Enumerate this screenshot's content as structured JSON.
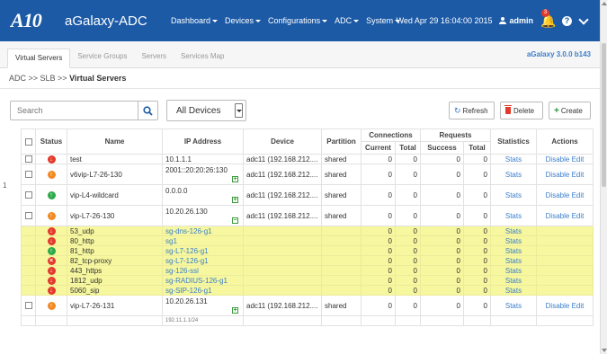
{
  "app": {
    "logo_text": "A10",
    "title": "aGalaxy-ADC",
    "nav": [
      "Dashboard",
      "Devices",
      "Configurations",
      "ADC",
      "System"
    ],
    "datetime": "Wed Apr 29 16:04:00 2015",
    "user": "admin",
    "notifications": "3",
    "help": "?"
  },
  "tabs": [
    "Virtual Servers",
    "Service Groups",
    "Servers",
    "Services Map"
  ],
  "version": "aGalaxy 3.0.0 b143",
  "breadcrumb": {
    "prefix": "ADC  >>  SLB  >>",
    "current": "Virtual Servers"
  },
  "toolbar": {
    "search_placeholder": "Search",
    "device_select": "All Devices",
    "refresh": "Refresh",
    "delete": "Delete",
    "create": "Create"
  },
  "table": {
    "group_headers": {
      "connections": "Connections",
      "requests": "Requests"
    },
    "headers": {
      "status": "Status",
      "name": "Name",
      "ip": "IP Address",
      "device": "Device",
      "partition": "Partition",
      "current": "Current",
      "total": "Total",
      "success": "Success",
      "req_total": "Total",
      "statistics": "Statistics",
      "actions": "Actions"
    },
    "rows": [
      {
        "name": "test",
        "ip": "10.1.1.1",
        "device": "adc11 (192.168.212....",
        "partition": "shared",
        "current": "0",
        "total": "0",
        "success": "0",
        "req_total": "0",
        "stats": "Stats",
        "disable": "Disable",
        "edit": "Edit"
      },
      {
        "name": "v6vip-L7-26-130",
        "ip": "2001::20:20:26:130",
        "device": "adc11 (192.168.212....",
        "partition": "shared",
        "current": "0",
        "total": "0",
        "success": "0",
        "req_total": "0",
        "stats": "Stats",
        "disable": "Disable",
        "edit": "Edit"
      },
      {
        "name": "vip-L4-wildcard",
        "ip": "0.0.0.0",
        "device": "adc11 (192.168.212....",
        "partition": "shared",
        "current": "0",
        "total": "0",
        "success": "0",
        "req_total": "0",
        "stats": "Stats",
        "disable": "Disable",
        "edit": "Edit"
      },
      {
        "name": "vip-L7-26-130",
        "ip": "10.20.26.130",
        "device": "adc11 (192.168.212....",
        "partition": "shared",
        "current": "0",
        "total": "0",
        "success": "0",
        "req_total": "0",
        "stats": "Stats",
        "disable": "Disable",
        "edit": "Edit"
      }
    ],
    "ports": [
      {
        "name": "53_udp",
        "sg": "sg-dns-126-g1",
        "current": "0",
        "total": "0",
        "success": "0",
        "req_total": "0",
        "stats": "Stats"
      },
      {
        "name": "80_http",
        "sg": "sg1",
        "current": "0",
        "total": "0",
        "success": "0",
        "req_total": "0",
        "stats": "Stats"
      },
      {
        "name": "81_http",
        "sg": "sg-L7-126-g1",
        "current": "0",
        "total": "0",
        "success": "0",
        "req_total": "0",
        "stats": "Stats"
      },
      {
        "name": "82_tcp-proxy",
        "sg": "sg-L7-126-g1",
        "current": "0",
        "total": "0",
        "success": "0",
        "req_total": "0",
        "stats": "Stats"
      },
      {
        "name": "443_https",
        "sg": "sg-126-ssl",
        "current": "0",
        "total": "0",
        "success": "0",
        "req_total": "0",
        "stats": "Stats"
      },
      {
        "name": "1812_udp",
        "sg": "sg-RADIUS-126-g1",
        "current": "0",
        "total": "0",
        "success": "0",
        "req_total": "0",
        "stats": "Stats"
      },
      {
        "name": "5060_sip",
        "sg": "sg-SIP-126-g1",
        "current": "0",
        "total": "0",
        "success": "0",
        "req_total": "0",
        "stats": "Stats"
      }
    ],
    "last_row": {
      "name": "vip-L7-26-131",
      "ip": "10.20.26.131",
      "device": "adc11 (192.168.212....",
      "partition": "shared",
      "current": "0",
      "total": "0",
      "success": "0",
      "req_total": "0",
      "stats": "Stats",
      "disable": "Disable",
      "edit": "Edit"
    },
    "cut_row_ip": "192.11.1.1/24"
  },
  "margin_marks": {
    "left": "1",
    "right": "="
  },
  "colors": {
    "nav_bg": "#1c5aa6",
    "link": "#3b7ecb",
    "highlight": "#f6f79e",
    "up": "#2eaa4a",
    "down": "#e23a2b",
    "partial": "#f08a24"
  }
}
